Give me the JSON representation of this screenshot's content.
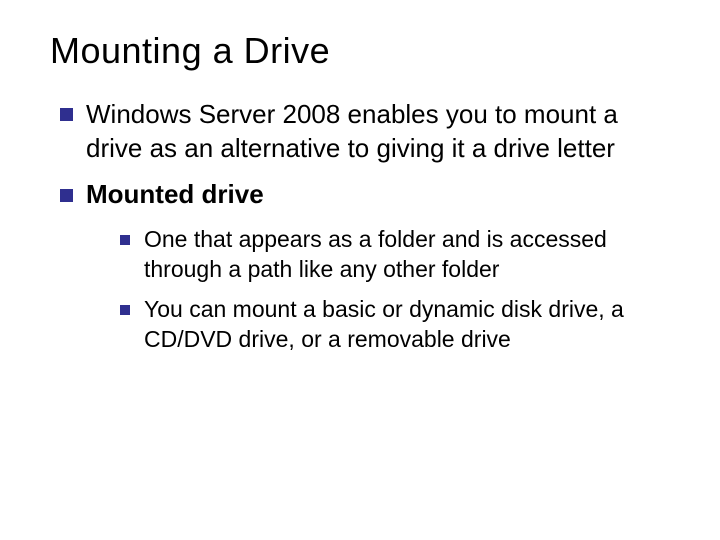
{
  "title": "Mounting a Drive",
  "bullets": {
    "b1": "Windows Server 2008 enables you to mount a drive as an alternative to giving it a drive letter",
    "b2": "Mounted drive",
    "b2_sub1": "One that appears as a folder and is accessed through a path like any other folder",
    "b2_sub2": "You can mount a basic or dynamic disk drive, a CD/DVD drive, or a removable drive"
  }
}
